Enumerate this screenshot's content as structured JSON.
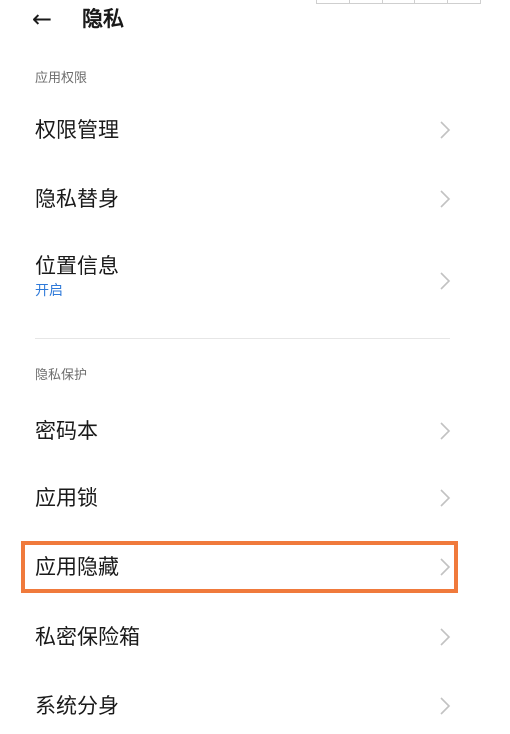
{
  "header": {
    "back_icon": "arrow-left-icon",
    "title": "隐私"
  },
  "sections": [
    {
      "header": "应用权限",
      "items": [
        {
          "label": "权限管理"
        },
        {
          "label": "隐私替身"
        },
        {
          "label": "位置信息",
          "sub": "开启"
        }
      ]
    },
    {
      "header": "隐私保护",
      "items": [
        {
          "label": "密码本"
        },
        {
          "label": "应用锁"
        },
        {
          "label": "应用隐藏"
        },
        {
          "label": "私密保险箱"
        },
        {
          "label": "系统分身"
        }
      ]
    }
  ],
  "colors": {
    "subtext_accent": "#2f7ad9",
    "highlight": "#f07a3c",
    "section_header": "#6d6d6d",
    "chevron": "#c2c2c2"
  },
  "icons": {
    "chevron": "chevron-right-icon"
  }
}
